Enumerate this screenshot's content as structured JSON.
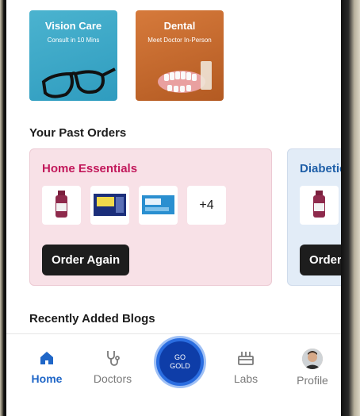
{
  "categories": [
    {
      "title": "Vision Care",
      "subtitle": "Consult in 10 Mins",
      "icon": "eyeglasses-image"
    },
    {
      "title": "Dental",
      "subtitle": "Meet Doctor In-Person",
      "icon": "dentures-image"
    }
  ],
  "past_orders": {
    "title": "Your Past Orders",
    "cards": [
      {
        "title": "Home Essentials",
        "more_label": "+4",
        "button": "Order Again"
      },
      {
        "title": "Diabetic",
        "button": "Order"
      }
    ]
  },
  "blogs": {
    "title": "Recently Added Blogs"
  },
  "nav": {
    "home": "Home",
    "doctors": "Doctors",
    "go_gold_line1": "GO",
    "go_gold_line2": "GOLD",
    "labs": "Labs",
    "profile": "Profile"
  },
  "colors": {
    "accent": "#1f66c7",
    "home_essentials": "#c2185b",
    "diabetic": "#1f5fa8"
  }
}
